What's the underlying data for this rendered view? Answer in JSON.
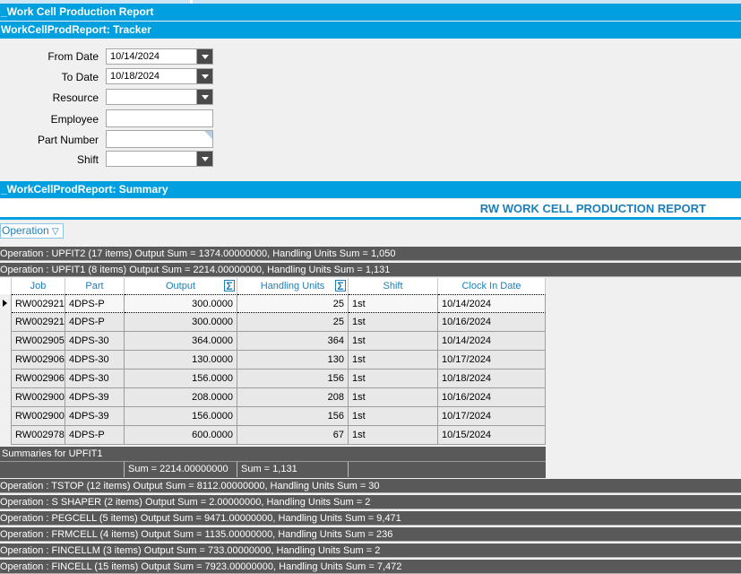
{
  "window": {
    "title": "_Work Cell Production Report",
    "tracker_title": "WorkCellProdReport: Tracker",
    "summary_title": "_WorkCellProdReport: Summary"
  },
  "tracker": {
    "from_date_label": "From Date",
    "from_date_value": "10/14/2024",
    "to_date_label": "To Date",
    "to_date_value": "10/18/2024",
    "resource_label": "Resource",
    "resource_value": "",
    "employee_label": "Employee",
    "employee_value": "",
    "part_number_label": "Part Number",
    "part_number_value": "",
    "shift_label": "Shift",
    "shift_value": ""
  },
  "report": {
    "title": "RW WORK CELL PRODUCTION REPORT",
    "group_by_label": "Operation",
    "groups_before": [
      "Operation : UPFIT2 (17 items) Output Sum = 1374.00000000, Handling Units Sum = 1,050",
      "Operation : UPFIT1 (8 items) Output Sum = 2214.00000000, Handling Units Sum = 1,131"
    ],
    "columns": {
      "job": "Job",
      "part": "Part",
      "output": "Output",
      "handling_units": "Handling Units",
      "shift": "Shift",
      "clock_in_date": "Clock In Date"
    },
    "rows": [
      {
        "job": "RW002921",
        "part": "4DPS-P",
        "output": "300.0000",
        "handling_units": "25",
        "shift": "1st",
        "clock_in_date": "10/14/2024"
      },
      {
        "job": "RW002921",
        "part": "4DPS-P",
        "output": "300.0000",
        "handling_units": "25",
        "shift": "1st",
        "clock_in_date": "10/16/2024"
      },
      {
        "job": "RW002905",
        "part": "4DPS-30",
        "output": "364.0000",
        "handling_units": "364",
        "shift": "1st",
        "clock_in_date": "10/14/2024"
      },
      {
        "job": "RW002906",
        "part": "4DPS-30",
        "output": "130.0000",
        "handling_units": "130",
        "shift": "1st",
        "clock_in_date": "10/17/2024"
      },
      {
        "job": "RW002906",
        "part": "4DPS-30",
        "output": "156.0000",
        "handling_units": "156",
        "shift": "1st",
        "clock_in_date": "10/18/2024"
      },
      {
        "job": "RW002900",
        "part": "4DPS-39",
        "output": "208.0000",
        "handling_units": "208",
        "shift": "1st",
        "clock_in_date": "10/16/2024"
      },
      {
        "job": "RW002900",
        "part": "4DPS-39",
        "output": "156.0000",
        "handling_units": "156",
        "shift": "1st",
        "clock_in_date": "10/17/2024"
      },
      {
        "job": "RW002978",
        "part": "4DPS-P",
        "output": "600.0000",
        "handling_units": "67",
        "shift": "1st",
        "clock_in_date": "10/15/2024"
      }
    ],
    "summaries_label": "Summaries for UPFIT1",
    "summary_output": "Sum = 2214.00000000",
    "summary_handling": "Sum = 1,131",
    "groups_after": [
      "Operation : TSTOP (12 items) Output Sum = 8112.00000000, Handling Units Sum = 30",
      "Operation : S SHAPER (2 items) Output Sum = 2.00000000, Handling Units Sum = 2",
      "Operation : PEGCELL (5 items) Output Sum = 9471.00000000, Handling Units Sum = 9,471",
      "Operation : FRMCELL (4 items) Output Sum = 1135.00000000, Handling Units Sum = 236",
      "Operation : FINCELLM (3 items) Output Sum = 733.00000000, Handling Units Sum = 2",
      "Operation : FINCELL (15 items) Output Sum = 7923.00000000, Handling Units Sum = 7,472"
    ]
  },
  "colors": {
    "accent": "#00a0e0",
    "header_text": "#1e7fb6",
    "group_row": "#595959"
  }
}
